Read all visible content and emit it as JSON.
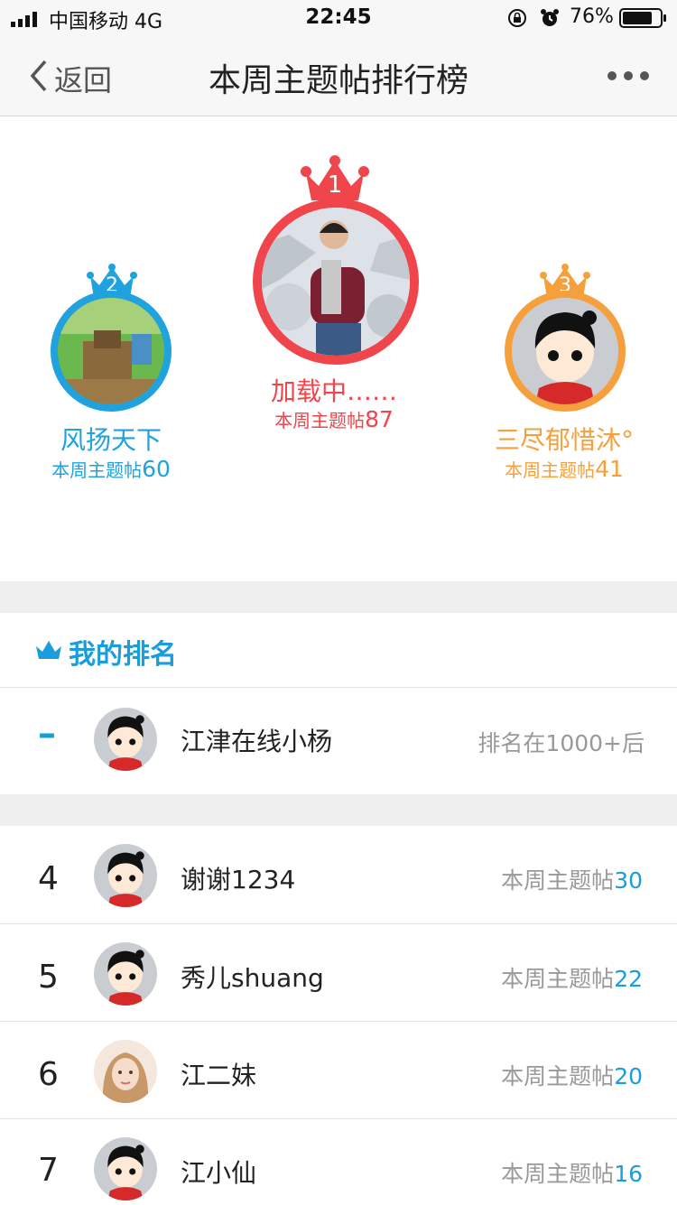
{
  "status_bar": {
    "carrier": "中国移动  4G",
    "time": "22:45",
    "battery": "76%"
  },
  "nav": {
    "back_label": "返回",
    "title": "本周主题帖排行榜"
  },
  "podium": [
    {
      "rank": "1",
      "name": "加载中……",
      "score_label": "本周主题帖",
      "score": "87",
      "color": "#f0454a"
    },
    {
      "rank": "2",
      "name": "风扬天下",
      "score_label": "本周主题帖",
      "score": "60",
      "color": "#1fa2dd"
    },
    {
      "rank": "3",
      "name": "三尽郁惜沐°",
      "score_label": "本周主题帖",
      "score": "41",
      "color": "#f5a03c"
    }
  ],
  "my_rank": {
    "title": "我的排名",
    "rank": "–",
    "name": "江津在线小杨",
    "status": "排名在1000+后"
  },
  "ranking": [
    {
      "rank": "4",
      "name": "谢谢1234",
      "score_label": "本周主题帖",
      "score": "30"
    },
    {
      "rank": "5",
      "name": "秀儿shuang",
      "score_label": "本周主题帖",
      "score": "22"
    },
    {
      "rank": "6",
      "name": "江二妹",
      "score_label": "本周主题帖",
      "score": "20"
    },
    {
      "rank": "7",
      "name": "江小仙",
      "score_label": "本周主题帖",
      "score": "16"
    }
  ],
  "colors": {
    "accent_blue": "#1a9ddd",
    "gold": "#f0454a",
    "silver": "#1fa2dd",
    "bronze": "#f5a03c"
  }
}
